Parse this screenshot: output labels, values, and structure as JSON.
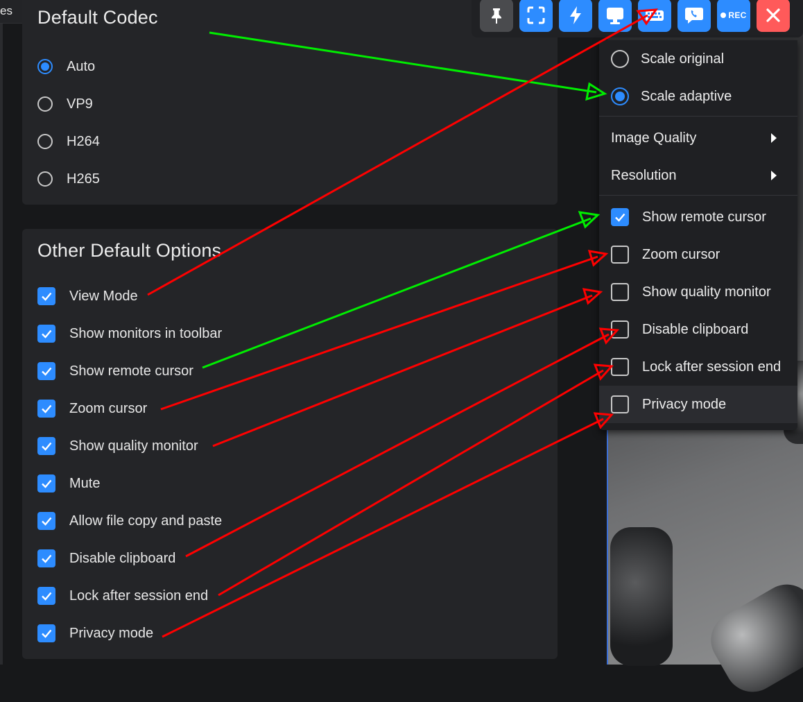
{
  "top_tab": {
    "label": "es"
  },
  "codec": {
    "title": "Default Codec",
    "options": [
      {
        "label": "Auto",
        "selected": true
      },
      {
        "label": "VP9",
        "selected": false
      },
      {
        "label": "H264",
        "selected": false
      },
      {
        "label": "H265",
        "selected": false
      }
    ]
  },
  "other": {
    "title": "Other Default Options",
    "options": [
      {
        "label": "View Mode",
        "checked": true
      },
      {
        "label": "Show monitors in toolbar",
        "checked": true
      },
      {
        "label": "Show remote cursor",
        "checked": true
      },
      {
        "label": "Zoom cursor",
        "checked": true
      },
      {
        "label": "Show quality monitor",
        "checked": true
      },
      {
        "label": "Mute",
        "checked": true
      },
      {
        "label": "Allow file copy and paste",
        "checked": true
      },
      {
        "label": "Disable clipboard",
        "checked": true
      },
      {
        "label": "Lock after session end",
        "checked": true
      },
      {
        "label": "Privacy mode",
        "checked": true
      }
    ]
  },
  "toolbar": {
    "buttons": [
      {
        "name": "pin",
        "icon": "pin-icon"
      },
      {
        "name": "fullscreen",
        "icon": "fullscreen-icon"
      },
      {
        "name": "actions",
        "icon": "lightning-icon"
      },
      {
        "name": "display",
        "icon": "monitor-icon"
      },
      {
        "name": "keyboard",
        "icon": "keyboard-icon"
      },
      {
        "name": "chat",
        "icon": "chat-icon"
      },
      {
        "name": "record",
        "icon": "record-icon",
        "label": "REC"
      },
      {
        "name": "close",
        "icon": "close-icon"
      }
    ]
  },
  "menu": {
    "scale_original": "Scale original",
    "scale_adaptive": "Scale adaptive",
    "image_quality": "Image Quality",
    "resolution": "Resolution",
    "toggles": [
      {
        "label": "Show remote cursor",
        "checked": true
      },
      {
        "label": "Zoom cursor",
        "checked": false
      },
      {
        "label": "Show quality monitor",
        "checked": false
      },
      {
        "label": "Disable clipboard",
        "checked": false
      },
      {
        "label": "Lock after session end",
        "checked": false
      },
      {
        "label": "Privacy mode",
        "checked": false
      }
    ]
  },
  "colors": {
    "accent": "#2d8cff",
    "close": "#ff5a5a",
    "arrow_red": "#ff0000",
    "arrow_green": "#00ee00"
  }
}
